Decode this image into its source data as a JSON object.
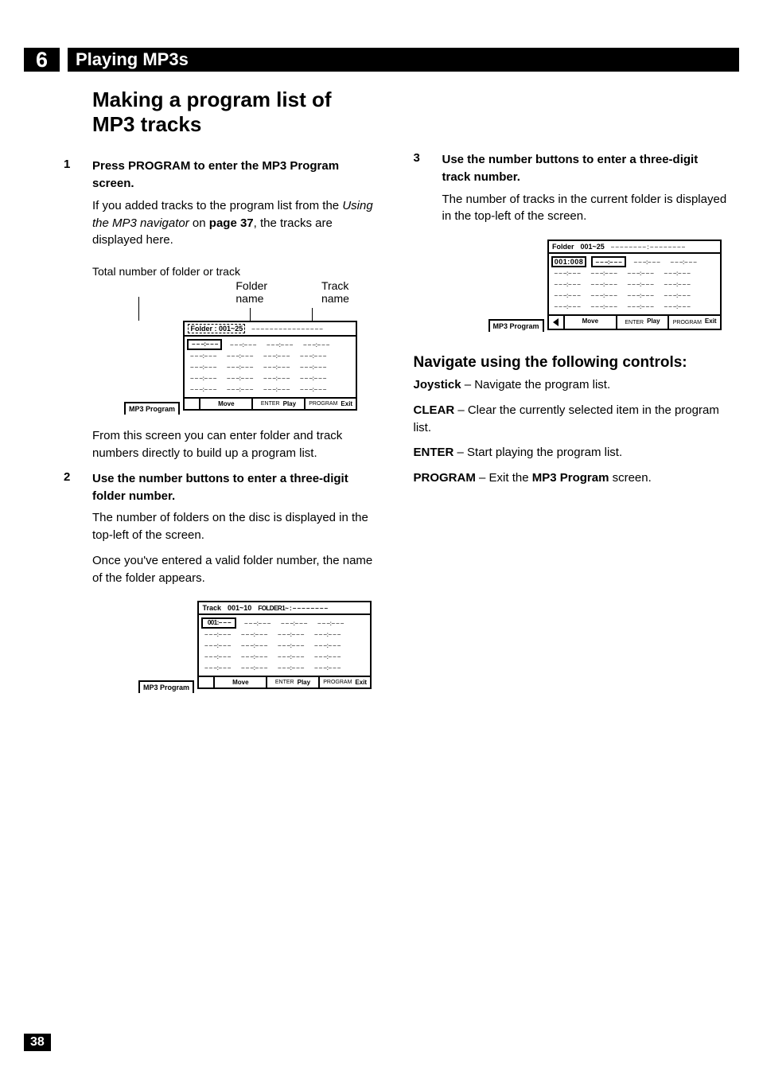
{
  "chapter": {
    "number": "6",
    "title": "Playing MP3s"
  },
  "section": {
    "title": "Making a program list of MP3 tracks"
  },
  "steps": [
    {
      "num": "1",
      "head": "Press PROGRAM to enter the MP3 Program screen.",
      "body_a": "If you added tracks to the program list from the ",
      "body_em": "Using the MP3 navigator",
      "body_b": " on ",
      "body_bold": "page 37",
      "body_c": ", the tracks are displayed here.",
      "note": "Total number of folder or track",
      "annot_folder": "Folder name",
      "annot_track": "Track name",
      "after": "From this screen you can enter folder and track numbers directly to build up a program list."
    },
    {
      "num": "2",
      "head": "Use the number buttons to enter a three-digit folder number.",
      "body_a": "The number of folders on the disc is displayed in the top-left of the screen.",
      "body_b": "Once you've entered a valid folder number, the name of the folder appears."
    },
    {
      "num": "3",
      "head": "Use the number buttons to enter a three-digit track number.",
      "body_a": "The number of tracks in the current folder is displayed in the top-left of the screen."
    }
  ],
  "screenshots": {
    "tab": "MP3 Program",
    "footer": {
      "move": "Move",
      "enter": "ENTER",
      "play": "Play",
      "program": "PROGRAM",
      "exit": "Exit"
    },
    "s1": {
      "top_lbl": "Folder : 001~25",
      "dashes": "– – – – – – – –   – – – – – – – –",
      "first_cell": "– – –:– – –"
    },
    "s2": {
      "top_a": "Track",
      "top_b": "001~10",
      "top_c": "FOLDER1~ : – – – – – – – –",
      "first_cell": "001:– – –"
    },
    "s3": {
      "top_a": "Folder",
      "top_b": "001~25",
      "top_c": "– – – – – – – – : – – – – – – – –",
      "first_cell": "001:008"
    }
  },
  "nav": {
    "heading": "Navigate using the following controls:",
    "lines": [
      {
        "b": "Joystick",
        "t": " – Navigate the program list."
      },
      {
        "b": "CLEAR",
        "t": " – Clear the currently selected item in the program list."
      },
      {
        "b": "ENTER",
        "t": " – Start playing the program list."
      },
      {
        "b": "PROGRAM",
        "t_a": " – Exit the ",
        "t_b": "MP3 Program",
        "t_c": " screen."
      }
    ]
  },
  "page_number": "38"
}
